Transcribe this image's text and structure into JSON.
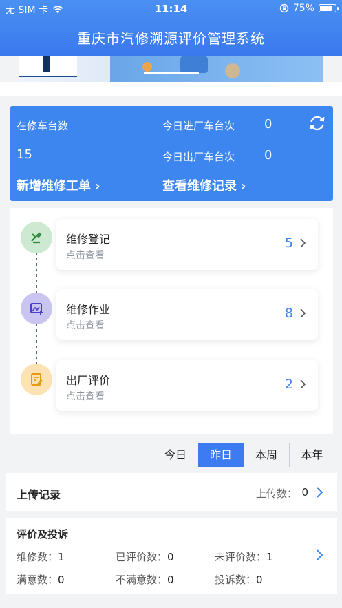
{
  "status_bar": {
    "carrier": "无 SIM 卡",
    "time": "11:14",
    "battery": "75%"
  },
  "app_title": "重庆市汽修溯源评价管理系统",
  "stats": {
    "repairing_label": "在修车台数",
    "repairing_value": "15",
    "in_today_label": "今日进厂车台次",
    "in_today_value": "0",
    "out_today_label": "今日出厂车台次",
    "out_today_value": "0",
    "new_order_link": "新增维修工单 ›",
    "view_records_link": "查看维修记录 ›"
  },
  "flow": [
    {
      "title": "维修登记",
      "sub": "点击查看",
      "count": "5",
      "icon": "repair-register-icon",
      "color": "#cde9d2"
    },
    {
      "title": "维修作业",
      "sub": "点击查看",
      "count": "8",
      "icon": "repair-work-icon",
      "color": "#c9c5f0"
    },
    {
      "title": "出厂评价",
      "sub": "点击查看",
      "count": "2",
      "icon": "exit-review-icon",
      "color": "#fde3b3"
    }
  ],
  "periods": {
    "today": "今日",
    "yesterday": "昨日",
    "week": "本周",
    "year": "本年",
    "active": "yesterday"
  },
  "upload": {
    "title": "上传记录",
    "count_label": "上传数：",
    "count": "0"
  },
  "review": {
    "title": "评价及投诉",
    "repairs_label": "维修数：",
    "repairs": "1",
    "reviewed_label": "已评价数：",
    "reviewed": "0",
    "unreviewed_label": "未评价数：",
    "unreviewed": "1",
    "satisfied_label": "满意数：",
    "satisfied": "0",
    "unsatisfied_label": "不满意数：",
    "unsatisfied": "0",
    "complaints_label": "投诉数：",
    "complaints": "0"
  },
  "colors": {
    "primary": "#3d86f0",
    "header": "#4a90f2"
  }
}
